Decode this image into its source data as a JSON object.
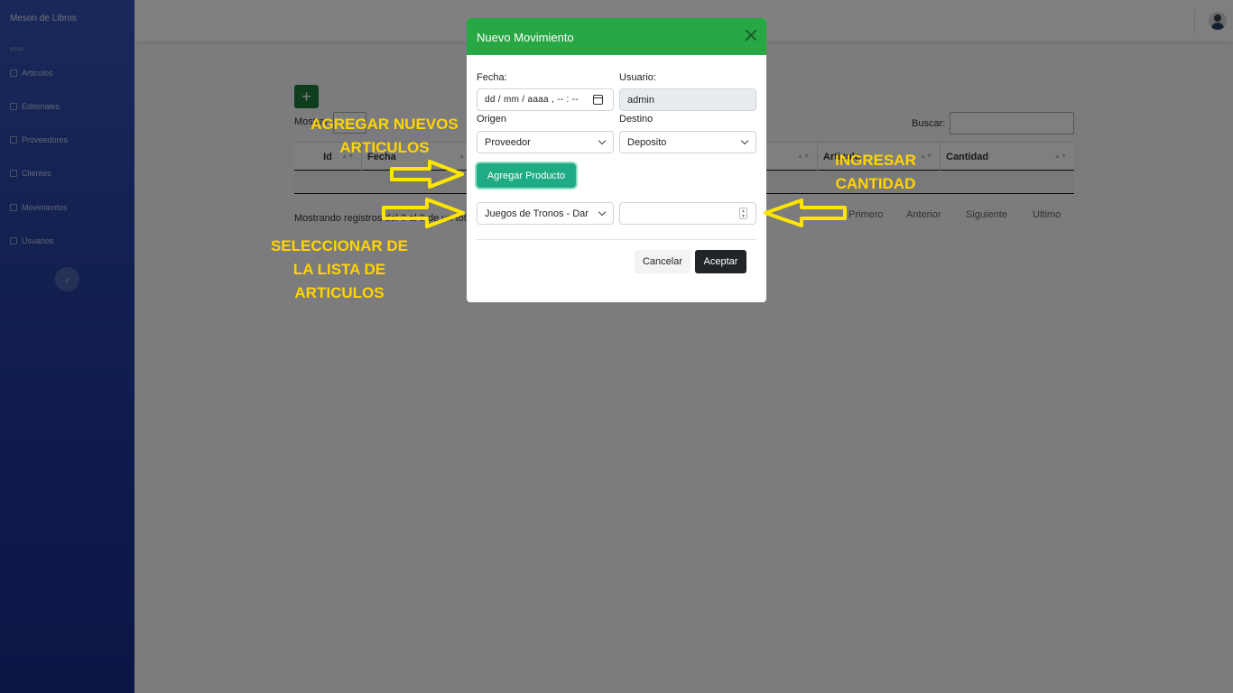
{
  "sidebar": {
    "brand": "Meson de Libros",
    "heading": "MENU",
    "items": [
      {
        "label": "Articulos"
      },
      {
        "label": "Editoriales"
      },
      {
        "label": "Proveedores"
      },
      {
        "label": "Clientes"
      },
      {
        "label": "Movimientos"
      },
      {
        "label": "Usuarios"
      }
    ],
    "toggle_icon": "chevron-left-icon"
  },
  "page": {
    "add_icon": "+",
    "show_label": "Mostrar",
    "search_label": "Buscar:",
    "table": {
      "headers": [
        "Id",
        "Fecha",
        "Articulo",
        "Cantidad"
      ]
    },
    "info_text": "Mostrando registros del 0 al 0 de un total de 0",
    "pagination": [
      "Primero",
      "Anterior",
      "Siguiente",
      "Ultimo"
    ]
  },
  "modal": {
    "title": "Nuevo Movimiento",
    "fecha_label": "Fecha:",
    "fecha_placeholder": "dd / mm / aaaa ,  -- : --",
    "usuario_label": "Usuario:",
    "usuario_value": "admin",
    "origen_label": "Origen",
    "origen_value": "Proveedor",
    "destino_label": "Destino",
    "destino_value": "Deposito",
    "add_product_label": "Agregar Producto",
    "article_select_value": "Juegos de Tronos - Dar",
    "quantity_value": "",
    "cancel_label": "Cancelar",
    "accept_label": "Aceptar"
  },
  "annotations": {
    "add_new": [
      "AGREGAR NUEVOS",
      "ARTICULOS"
    ],
    "quantity": [
      "INGRESAR",
      "CANTIDAD"
    ],
    "select_list": [
      "SELECCIONAR DE",
      "LA LISTA DE",
      "ARTICULOS"
    ],
    "color": "#ffd500"
  },
  "colors": {
    "modal_header": "#28a745",
    "add_product_button": "#1fab83",
    "accept_button": "#212529",
    "sidebar": "#2540a0"
  }
}
